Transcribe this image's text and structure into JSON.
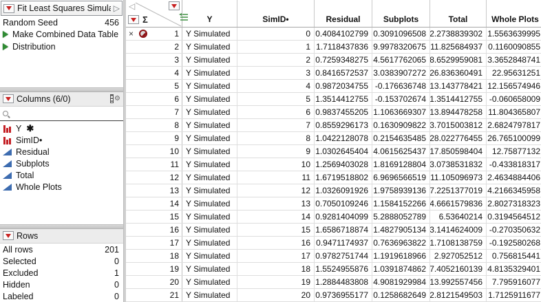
{
  "report_panel": {
    "title": "Fit Least Squares Simulat...",
    "open_arrow": "▷",
    "random_seed_label": "Random Seed",
    "random_seed_value": "456",
    "actions": [
      "Make Combined Data Table",
      "Distribution"
    ]
  },
  "columns_panel": {
    "title": "Columns (6/0)",
    "items": [
      {
        "label": "Y",
        "suffix": "✱",
        "icon": "nominal-column-icon"
      },
      {
        "label": "SimID•",
        "suffix": "",
        "icon": "nominal-column-icon"
      },
      {
        "label": "Residual",
        "suffix": "",
        "icon": "continuous-column-icon"
      },
      {
        "label": "Subplots",
        "suffix": "",
        "icon": "continuous-column-icon"
      },
      {
        "label": "Total",
        "suffix": "",
        "icon": "continuous-column-icon"
      },
      {
        "label": "Whole Plots",
        "suffix": "",
        "icon": "continuous-column-icon"
      }
    ]
  },
  "rows_panel": {
    "title": "Rows",
    "stats": [
      {
        "label": "All rows",
        "value": "201"
      },
      {
        "label": "Selected",
        "value": "0"
      },
      {
        "label": "Excluded",
        "value": "1"
      },
      {
        "label": "Hidden",
        "value": "0"
      },
      {
        "label": "Labeled",
        "value": "0"
      }
    ]
  },
  "table": {
    "corner_sigma": "Σ",
    "corner_collapse_arrow": "◁",
    "columns": [
      "Y",
      "SimID•",
      "Residual",
      "Subplots",
      "Total",
      "Whole Plots"
    ],
    "rows": [
      {
        "n": "1",
        "excluded": true,
        "cells": [
          "Y Simulated",
          "0",
          "0.4084102799",
          "0.3091096508",
          "2.2738839302",
          "1.5563639995"
        ]
      },
      {
        "n": "2",
        "excluded": false,
        "cells": [
          "Y Simulated",
          "1",
          "1.7118437836",
          "9.9978320675",
          "11.825684937",
          "0.1160090855"
        ]
      },
      {
        "n": "3",
        "excluded": false,
        "cells": [
          "Y Simulated",
          "2",
          "0.7259348275",
          "4.5617762065",
          "8.6529959081",
          "3.3652848741"
        ]
      },
      {
        "n": "4",
        "excluded": false,
        "cells": [
          "Y Simulated",
          "3",
          "0.8416572537",
          "3.0383907272",
          "26.836360491",
          "22.95631251"
        ]
      },
      {
        "n": "5",
        "excluded": false,
        "cells": [
          "Y Simulated",
          "4",
          "0.9872034755",
          "-0.176636748",
          "13.143778421",
          "12.156574946"
        ]
      },
      {
        "n": "6",
        "excluded": false,
        "cells": [
          "Y Simulated",
          "5",
          "1.3514412755",
          "-0.153702674",
          "1.3514412755",
          "-0.060658009"
        ]
      },
      {
        "n": "7",
        "excluded": false,
        "cells": [
          "Y Simulated",
          "6",
          "0.9837455205",
          "1.1063669307",
          "13.894478258",
          "11.804365807"
        ]
      },
      {
        "n": "8",
        "excluded": false,
        "cells": [
          "Y Simulated",
          "7",
          "0.8559296173",
          "0.1630909822",
          "3.7015003812",
          "2.6824797817"
        ]
      },
      {
        "n": "9",
        "excluded": false,
        "cells": [
          "Y Simulated",
          "8",
          "1.0422128078",
          "0.2154635485",
          "28.022776455",
          "26.765100099"
        ]
      },
      {
        "n": "10",
        "excluded": false,
        "cells": [
          "Y Simulated",
          "9",
          "1.0302645404",
          "4.0615625437",
          "17.850598404",
          "12.75877132"
        ]
      },
      {
        "n": "11",
        "excluded": false,
        "cells": [
          "Y Simulated",
          "10",
          "1.2569403028",
          "1.8169128804",
          "3.0738531832",
          "-0.433818317"
        ]
      },
      {
        "n": "12",
        "excluded": false,
        "cells": [
          "Y Simulated",
          "11",
          "1.6719518802",
          "6.9696566519",
          "11.105096973",
          "2.4634884406"
        ]
      },
      {
        "n": "13",
        "excluded": false,
        "cells": [
          "Y Simulated",
          "12",
          "1.0326091926",
          "1.9758939136",
          "7.2251377019",
          "4.2166345958"
        ]
      },
      {
        "n": "14",
        "excluded": false,
        "cells": [
          "Y Simulated",
          "13",
          "0.7050109246",
          "1.1584152266",
          "4.6661579836",
          "2.8027318323"
        ]
      },
      {
        "n": "15",
        "excluded": false,
        "cells": [
          "Y Simulated",
          "14",
          "0.9281404099",
          "5.2888052789",
          "6.53640214",
          "0.3194564512"
        ]
      },
      {
        "n": "16",
        "excluded": false,
        "cells": [
          "Y Simulated",
          "15",
          "1.6586718874",
          "1.4827905134",
          "3.1414624009",
          "-0.270350632"
        ]
      },
      {
        "n": "17",
        "excluded": false,
        "cells": [
          "Y Simulated",
          "16",
          "0.9471174937",
          "0.7636963822",
          "1.7108138759",
          "-0.192580268"
        ]
      },
      {
        "n": "18",
        "excluded": false,
        "cells": [
          "Y Simulated",
          "17",
          "0.9782751744",
          "1.1919618966",
          "2.927052512",
          "0.756815441"
        ]
      },
      {
        "n": "19",
        "excluded": false,
        "cells": [
          "Y Simulated",
          "18",
          "1.5524955876",
          "1.0391874862",
          "7.4052160139",
          "4.8135329401"
        ]
      },
      {
        "n": "20",
        "excluded": false,
        "cells": [
          "Y Simulated",
          "19",
          "1.2884483808",
          "4.9081929984",
          "13.992557456",
          "7.795916077"
        ]
      },
      {
        "n": "21",
        "excluded": false,
        "cells": [
          "Y Simulated",
          "20",
          "0.9736955177",
          "0.1258682649",
          "2.8121549503",
          "1.7125911677"
        ]
      }
    ]
  },
  "colors": {
    "accent_red": "#c82121",
    "accent_green": "#2f8b33",
    "continuous_blue": "#3d6cb0",
    "nominal_red": "#c41f25"
  }
}
